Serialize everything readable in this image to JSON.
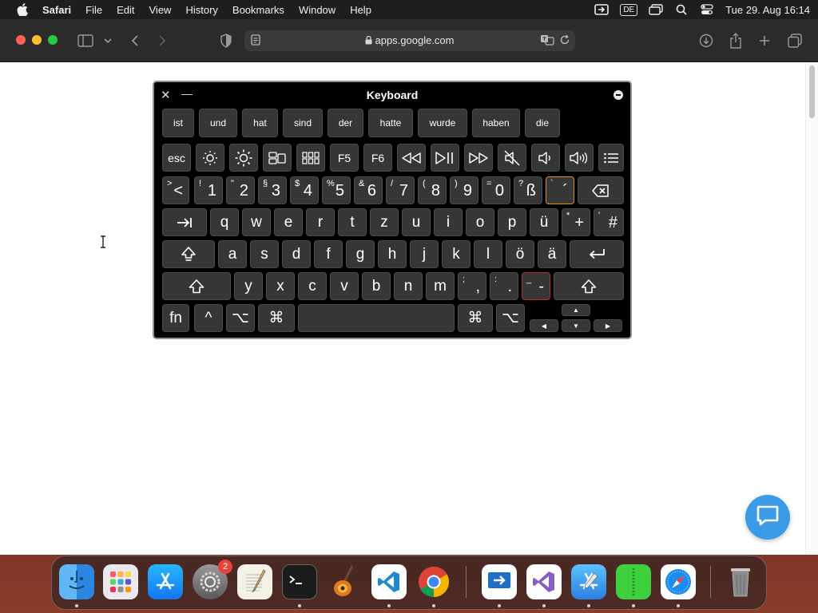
{
  "menubar": {
    "app_name": "Safari",
    "items": [
      "File",
      "Edit",
      "View",
      "History",
      "Bookmarks",
      "Window",
      "Help"
    ],
    "input_source": "DE",
    "clock": "Tue 29. Aug  16:14"
  },
  "browser": {
    "url": "apps.google.com"
  },
  "keyboard": {
    "title": "Keyboard",
    "suggestions": [
      "ist",
      "und",
      "hat",
      "sind",
      "der",
      "hatte",
      "wurde",
      "haben",
      "die"
    ],
    "fn_row": {
      "esc": "esc",
      "f5": "F5",
      "f6": "F6"
    },
    "num_row": [
      {
        "shift": ">",
        "main": "<"
      },
      {
        "shift": "!",
        "main": "1"
      },
      {
        "shift": "\"",
        "main": "2"
      },
      {
        "shift": "§",
        "main": "3"
      },
      {
        "shift": "$",
        "main": "4"
      },
      {
        "shift": "%",
        "main": "5"
      },
      {
        "shift": "&",
        "main": "6"
      },
      {
        "shift": "/",
        "main": "7"
      },
      {
        "shift": "(",
        "main": "8"
      },
      {
        "shift": ")",
        "main": "9"
      },
      {
        "shift": "=",
        "main": "0"
      },
      {
        "shift": "?",
        "main": "ß"
      },
      {
        "shift": "`",
        "main": "´"
      }
    ],
    "row_q": [
      "q",
      "w",
      "e",
      "r",
      "t",
      "z",
      "u",
      "i",
      "o",
      "p",
      "ü"
    ],
    "plus_key": {
      "shift": "*",
      "main": "+"
    },
    "hash_key": {
      "shift": "'",
      "main": "#"
    },
    "row_a": [
      "a",
      "s",
      "d",
      "f",
      "g",
      "h",
      "j",
      "k",
      "l",
      "ö",
      "ä"
    ],
    "row_y": [
      "y",
      "x",
      "c",
      "v",
      "b",
      "n",
      "m"
    ],
    "comma_key": {
      "shift": ";",
      "main": ","
    },
    "period_key": {
      "shift": ":",
      "main": "."
    },
    "dash_key": {
      "shift": "_",
      "main": "-"
    },
    "bottom": {
      "fn": "fn",
      "ctrl": "^",
      "opt_left": "⌥",
      "cmd_left": "⌘",
      "cmd_right": "⌘",
      "opt_right": "⌥",
      "arrow_up": "▲",
      "arrow_left": "◀",
      "arrow_down": "▼",
      "arrow_right": "▶"
    }
  },
  "dock": {
    "system_settings_badge": "2"
  },
  "colors": {
    "chat_button": "#3c9be6",
    "highlight_orange": "#e08a2b",
    "highlight_red": "#b03030"
  }
}
